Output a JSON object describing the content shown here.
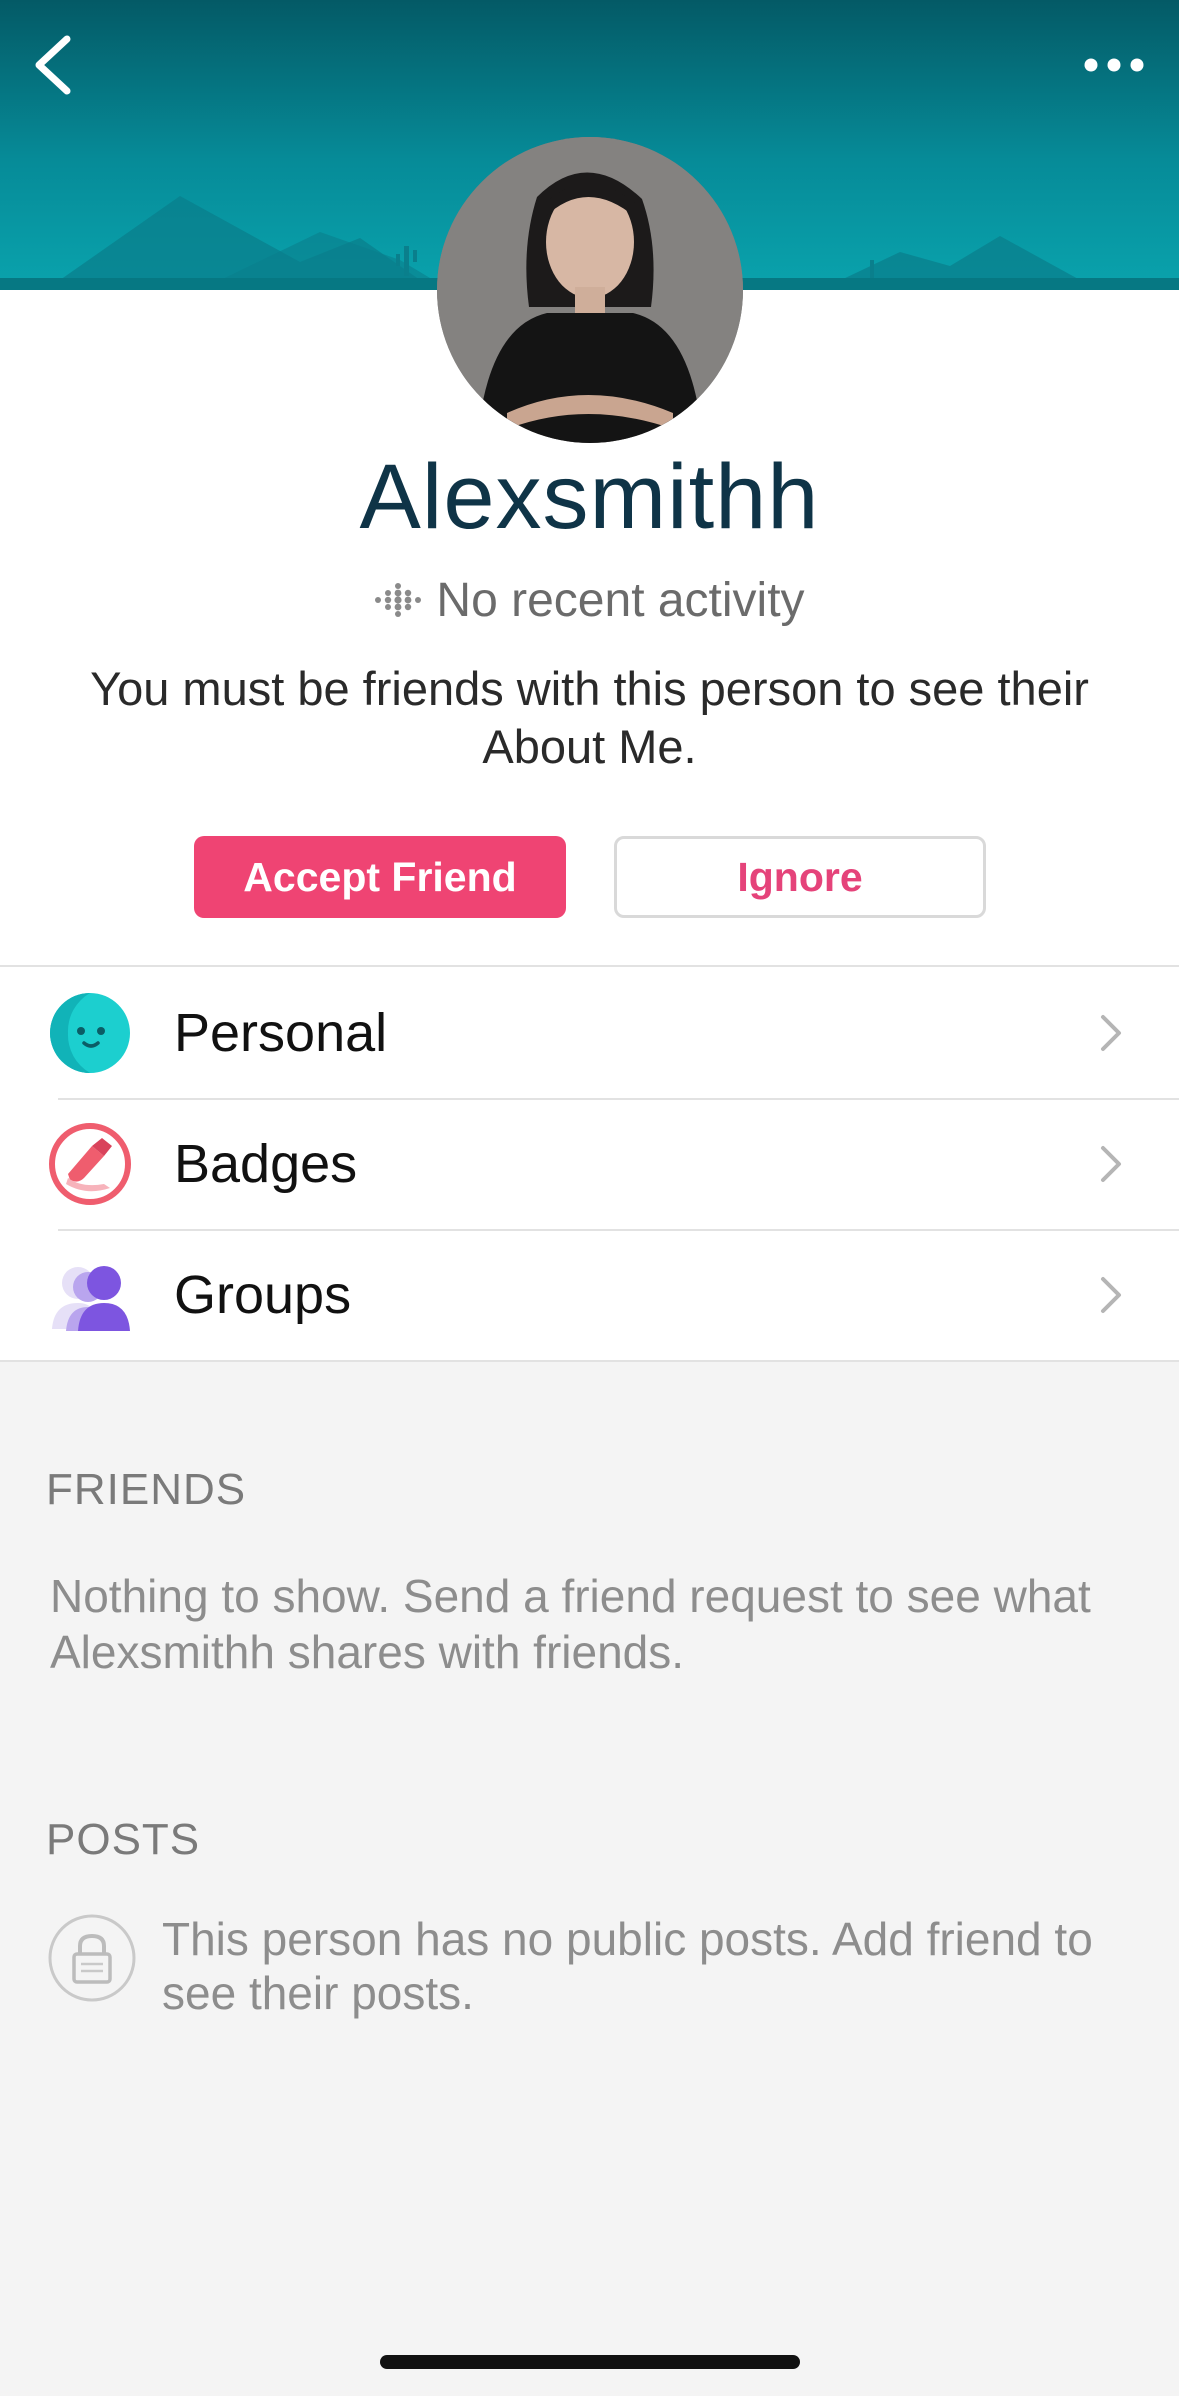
{
  "profile": {
    "username": "Alexsmithh",
    "activity_text": "No recent activity",
    "about_message": "You must be friends with this person to see their About Me."
  },
  "actions": {
    "accept_label": "Accept Friend",
    "ignore_label": "Ignore"
  },
  "menu": {
    "items": [
      {
        "label": "Personal",
        "icon": "smiley-face-icon"
      },
      {
        "label": "Badges",
        "icon": "shoe-badge-icon"
      },
      {
        "label": "Groups",
        "icon": "people-group-icon"
      }
    ]
  },
  "friends_section": {
    "title": "FRIENDS",
    "message": "Nothing to show. Send a friend request to see what Alexsmithh shares with friends."
  },
  "posts_section": {
    "title": "POSTS",
    "message": "This person has no public posts. Add friend to see their posts."
  },
  "colors": {
    "accent_pink": "#ef4473",
    "header_teal": "#068b98",
    "personal_teal": "#1ccfcf",
    "badges_red": "#ef5d6e",
    "groups_purple": "#7d55e0"
  }
}
